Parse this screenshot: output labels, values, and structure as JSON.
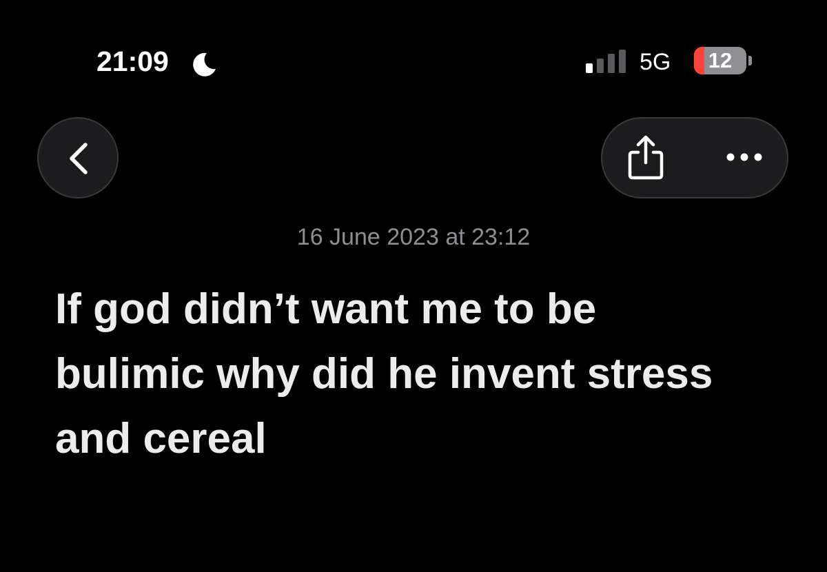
{
  "status_bar": {
    "time": "21:09",
    "focus_icon": "moon-icon",
    "signal_icon": "cellular-signal-icon",
    "network": "5G",
    "battery_percent": "12",
    "battery_level": 0.12,
    "battery_color": "#ff453a"
  },
  "nav": {
    "back_icon": "chevron-left-icon",
    "share_icon": "share-icon",
    "more_icon": "ellipsis-icon"
  },
  "note": {
    "date": "16 June 2023 at 23:12",
    "body": "If god didn’t want me to be bulimic why did he invent stress and cereal"
  }
}
